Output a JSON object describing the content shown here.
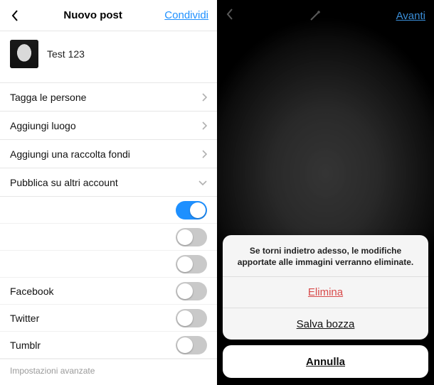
{
  "left": {
    "header": {
      "title": "Nuovo post",
      "share": "Condividi"
    },
    "caption": "Test 123",
    "rows": [
      {
        "label": "Tagga le persone",
        "kind": "chevron"
      },
      {
        "label": "Aggiungi luogo",
        "kind": "chevron"
      },
      {
        "label": "Aggiungi una raccolta fondi",
        "kind": "chevron"
      },
      {
        "label": "Pubblica su altri account",
        "kind": "down"
      }
    ],
    "toggles": [
      {
        "label": "",
        "on": true
      },
      {
        "label": "",
        "on": false
      },
      {
        "label": "",
        "on": false
      },
      {
        "label": "Facebook",
        "on": false
      },
      {
        "label": "Twitter",
        "on": false
      },
      {
        "label": "Tumblr",
        "on": false
      }
    ],
    "advanced": "Impostazioni avanzate"
  },
  "right": {
    "header": {
      "next": "Avanti"
    },
    "sheet": {
      "message": "Se torni indietro adesso, le modifiche apportate alle immagini verranno eliminate.",
      "delete": "Elimina",
      "save_draft": "Salva bozza",
      "cancel": "Annulla"
    }
  }
}
